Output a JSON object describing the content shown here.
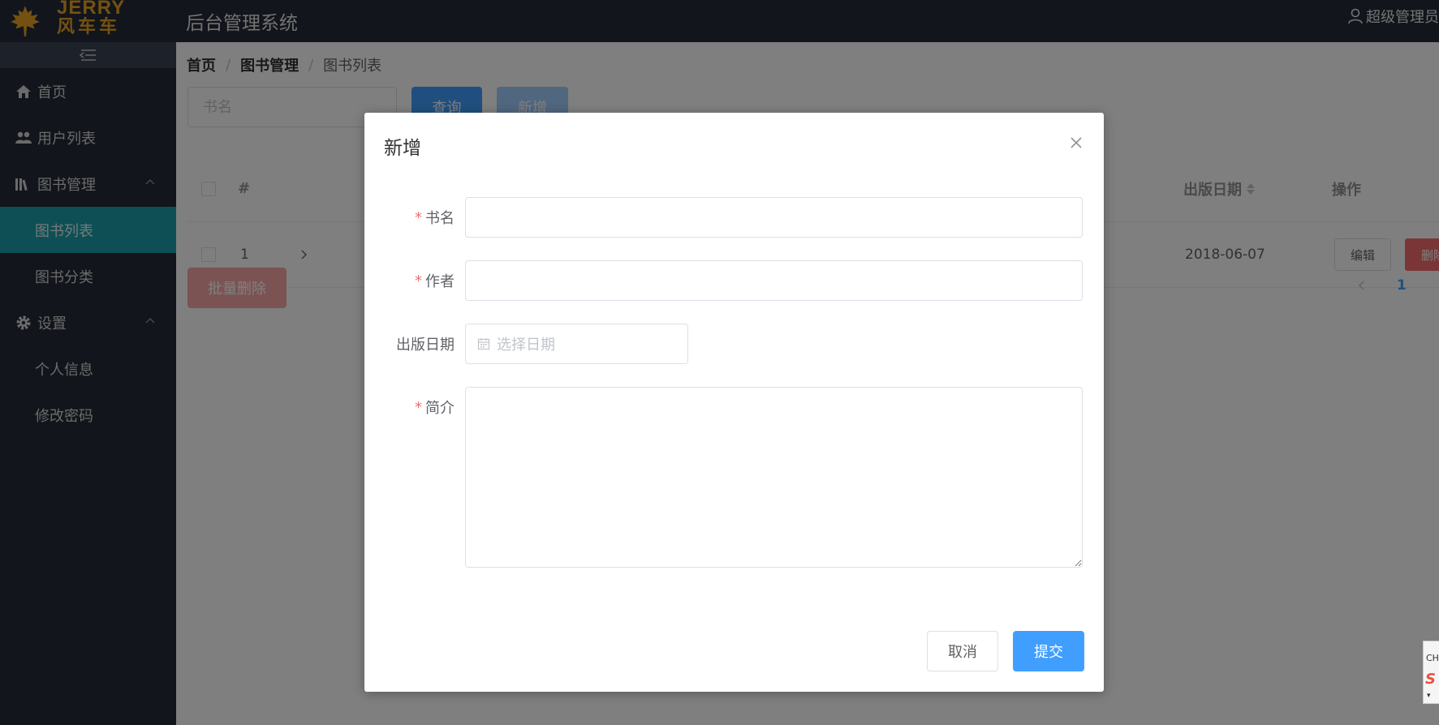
{
  "logo": {
    "en": "JERRY",
    "cn": "风车车"
  },
  "header": {
    "title": "后台管理系统",
    "user": "超级管理员"
  },
  "sidebar": {
    "items": [
      {
        "label": "首页"
      },
      {
        "label": "用户列表"
      },
      {
        "label": "图书管理"
      },
      {
        "label": "图书列表"
      },
      {
        "label": "图书分类"
      },
      {
        "label": "设置"
      },
      {
        "label": "个人信息"
      },
      {
        "label": "修改密码"
      }
    ]
  },
  "breadcrumb": {
    "home": "首页",
    "sep1": "/",
    "section": "图书管理",
    "sep2": "/",
    "current": "图书列表"
  },
  "toolbar": {
    "search_placeholder": "书名",
    "query_label": "查询",
    "add_label": "新增"
  },
  "table": {
    "headers": {
      "index": "#",
      "pubdate": "出版日期",
      "actions": "操作"
    },
    "rows": [
      {
        "index": "1",
        "pubdate": "2018-06-07"
      }
    ],
    "edit_label": "编辑",
    "delete_label": "删除",
    "batch_delete_label": "批量删除"
  },
  "pagination": {
    "current_page": "1"
  },
  "dialog": {
    "title": "新增",
    "required_mark": "*",
    "fields": {
      "name_label": "书名",
      "author_label": "作者",
      "pubdate_label": "出版日期",
      "pubdate_placeholder": "选择日期",
      "intro_label": "简介"
    },
    "cancel_label": "取消",
    "submit_label": "提交"
  },
  "float_widget": {
    "text": "CH",
    "logo": "S"
  },
  "colors": {
    "primary": "#409eff",
    "danger": "#f56c6c",
    "sidebar_bg": "#242a36",
    "active_menu": "#1a9fab",
    "logo": "#e8a224"
  }
}
